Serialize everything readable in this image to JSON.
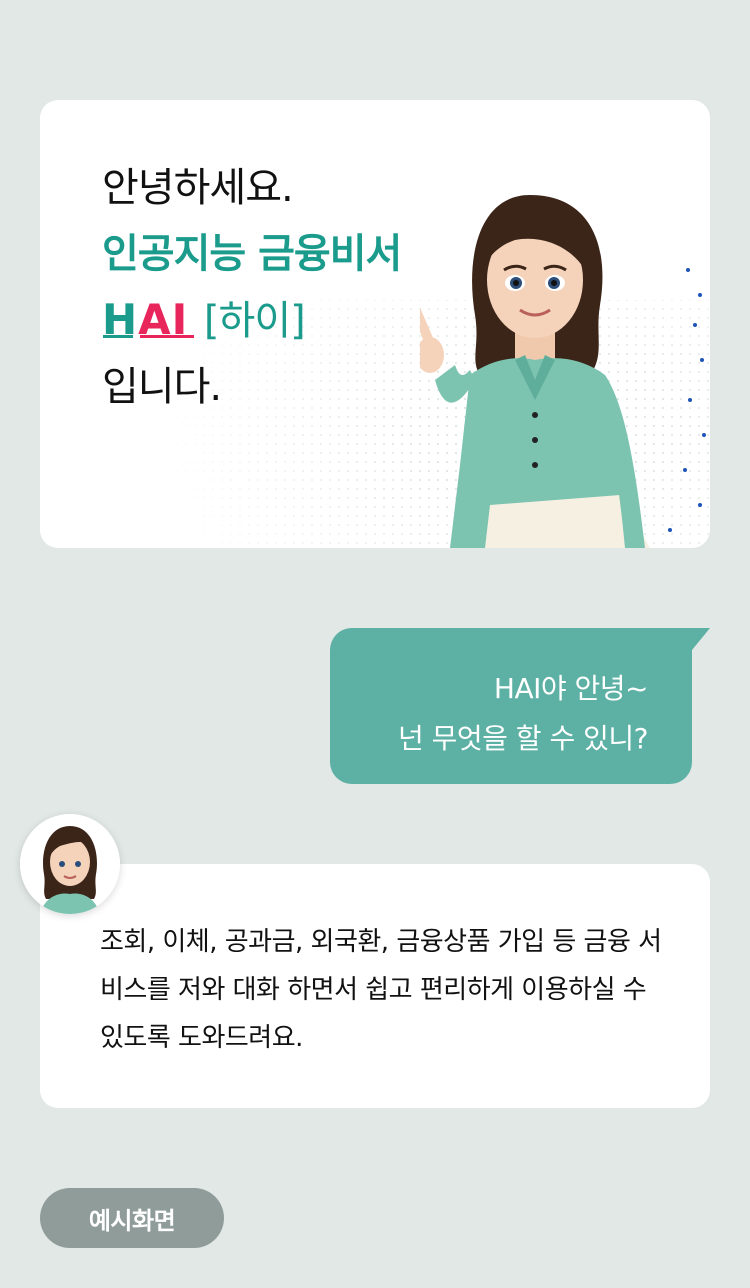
{
  "intro": {
    "line1": "안녕하세요.",
    "line2": "인공지능 금융비서",
    "logo_h": "H",
    "logo_ai": "AI",
    "pronunciation": "[하이]",
    "line4": "입니다."
  },
  "user_message": {
    "line1": "HAI야 안녕~",
    "line2": "넌 무엇을 할 수 있니?"
  },
  "bot_message": {
    "text": "조회, 이체, 공과금, 외국환, 금융상품 가입 등 금융 서비스를 저와 대화 하면서 쉽고 편리하게 이용하실 수 있도록 도와드려요."
  },
  "example_button": {
    "label": "예시화면"
  },
  "colors": {
    "background": "#e1e8e6",
    "teal": "#1a9b8c",
    "user_bubble": "#5db0a4",
    "pink": "#e8265c",
    "button": "#8f9c99"
  }
}
